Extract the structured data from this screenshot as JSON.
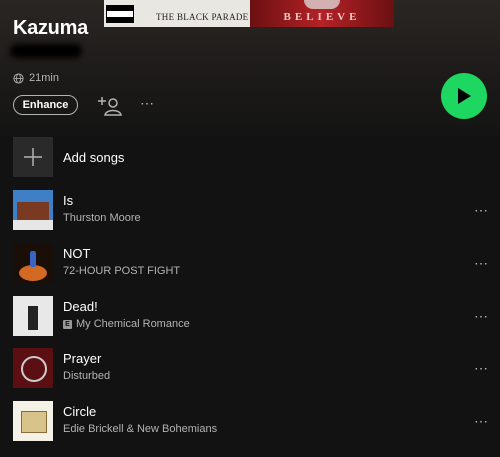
{
  "header": {
    "cover_left_text": "THE BLACK PARADE",
    "cover_right_text": "BELIEVE",
    "title": "Kazuma",
    "duration": "21min"
  },
  "actions": {
    "enhance_label": "Enhance",
    "more_label": "⋯",
    "accent_color": "#1ed760"
  },
  "add_songs": {
    "label": "Add songs"
  },
  "tracks": [
    {
      "title": "Is",
      "artist": "Thurston Moore",
      "explicit": false
    },
    {
      "title": "NOT",
      "artist": "72-HOUR POST FIGHT",
      "explicit": false
    },
    {
      "title": "Dead!",
      "artist": "My Chemical Romance",
      "explicit": true,
      "explicit_label": "E"
    },
    {
      "title": "Prayer",
      "artist": "Disturbed",
      "explicit": false
    },
    {
      "title": "Circle",
      "artist": "Edie Brickell & New Bohemians",
      "explicit": false
    }
  ],
  "track_more_label": "⋯"
}
